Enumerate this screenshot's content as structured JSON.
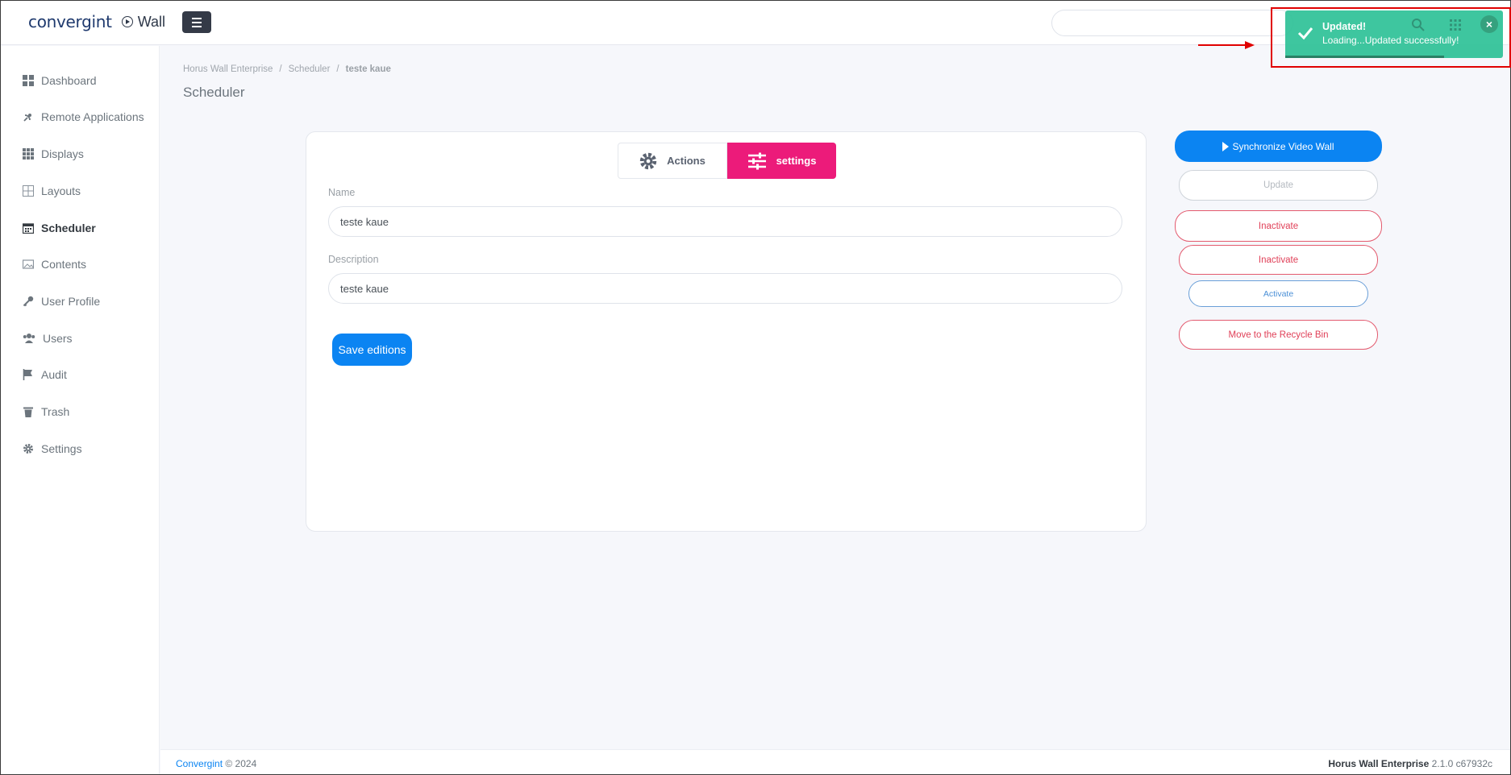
{
  "topbar": {
    "brand": "convergint",
    "product": "Wall",
    "search_placeholder": ""
  },
  "sidebar": {
    "items": [
      {
        "label": "Dashboard",
        "icon": "dashboard-icon"
      },
      {
        "label": "Remote Applications",
        "icon": "satellite-dish-icon"
      },
      {
        "label": "Displays",
        "icon": "grid-icon"
      },
      {
        "label": "Layouts",
        "icon": "layout-icon"
      },
      {
        "label": "Scheduler",
        "icon": "calendar-icon",
        "active": true
      },
      {
        "label": "Contents",
        "icon": "image-icon"
      },
      {
        "label": "User Profile",
        "icon": "key-icon"
      },
      {
        "label": "Users",
        "icon": "users-icon"
      },
      {
        "label": "Audit",
        "icon": "flag-icon"
      },
      {
        "label": "Trash",
        "icon": "trash-icon"
      },
      {
        "label": "Settings",
        "icon": "gear-icon"
      }
    ]
  },
  "breadcrumb": {
    "items": [
      "Horus Wall Enterprise",
      "Scheduler",
      "teste kaue"
    ],
    "separator": "/"
  },
  "page": {
    "title": "Scheduler"
  },
  "form": {
    "tabs": [
      {
        "label": "Actions",
        "icon": "gear-icon"
      },
      {
        "label": "settings",
        "icon": "sliders-icon",
        "active": true
      }
    ],
    "name_label": "Name",
    "name_value": "teste  kaue",
    "description_label": "Description",
    "description_value": "teste kaue",
    "save_label": "Save editions"
  },
  "actions": {
    "sync_label": "Synchronize Video Wall",
    "update_label": "Update",
    "inactivate_label_1": "Inactivate",
    "inactivate_label_2": "Inactivate",
    "activate_label": "Activate",
    "recycle_label": "Move to the Recycle Bin"
  },
  "toast": {
    "title": "Updated!",
    "message": "Loading...Updated successfully!",
    "close": "×",
    "progress": 0.73
  },
  "footer": {
    "company": "Convergint",
    "copyright": "© 2024",
    "product": "Horus Wall Enterprise",
    "version": "2.1.0 c67932c"
  },
  "colors": {
    "primary": "#0b84f2",
    "accent": "#ec1b7a",
    "danger": "#e04058",
    "success": "#34c39a",
    "annotation": "#e00000"
  }
}
